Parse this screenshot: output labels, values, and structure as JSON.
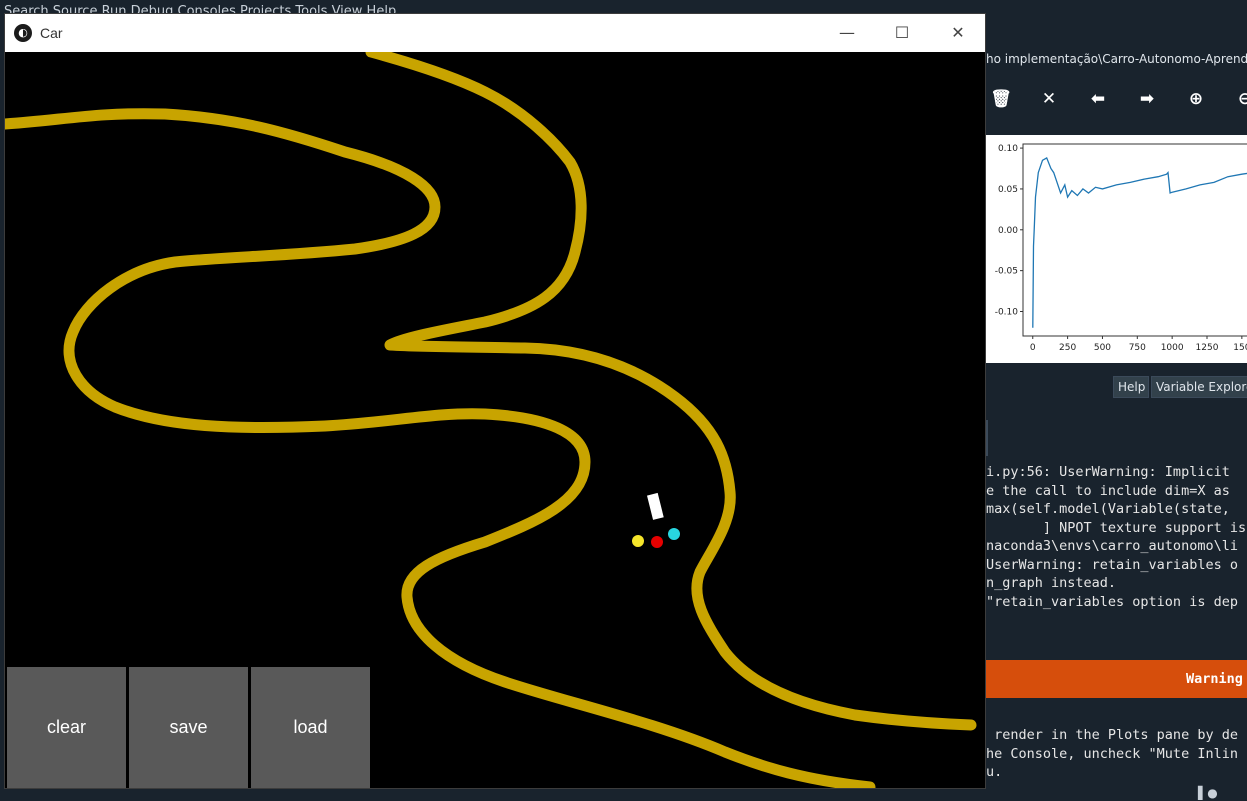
{
  "ide": {
    "menubar_text": "Search   Source   Run   Debug   Consoles   Projects   Tools   View   Help",
    "path_text": "ho implementação\\Carro-Autonomo-Aprendiz",
    "toolbar_icons": [
      "trash-icon",
      "close-all-icon",
      "arrow-left-icon",
      "arrow-right-icon",
      "zoom-in-icon",
      "zoom-out-icon"
    ],
    "pane_tabs": [
      "Help",
      "Variable Explorer"
    ],
    "console_lines": [
      "i.py:56: UserWarning: Implicit",
      "e the call to include dim=X as",
      "max(self.model(Variable(state,",
      "       ] NPOT texture support is",
      "naconda3\\envs\\carro_autonomo\\li",
      "UserWarning: retain_variables o",
      "n_graph instead.",
      "\"retain_variables option is dep",
      " render in the Plots pane by de",
      "he Console, uncheck \"Mute Inlin",
      "u."
    ],
    "warning_label": "Warning",
    "warning_color": "#d64e0c"
  },
  "plot": {
    "chart_data": {
      "type": "line",
      "yticks": [
        "0.10",
        "0.05",
        "0.00",
        "-0.05",
        "-0.10"
      ],
      "xticks": [
        "0",
        "250",
        "500",
        "750",
        "1000",
        "1250",
        "150"
      ],
      "ylim": [
        -0.13,
        0.105
      ],
      "xlim": [
        -70,
        1580
      ],
      "series": [
        {
          "color": "#1f77b4",
          "x": [
            0,
            5,
            10,
            20,
            40,
            70,
            100,
            130,
            150,
            170,
            200,
            230,
            250,
            280,
            320,
            360,
            400,
            450,
            500,
            600,
            700,
            800,
            900,
            960,
            970,
            985,
            1000,
            1100,
            1200,
            1300,
            1400,
            1500,
            1580
          ],
          "y": [
            -0.12,
            -0.02,
            0.0,
            0.04,
            0.07,
            0.085,
            0.088,
            0.075,
            0.07,
            0.06,
            0.045,
            0.055,
            0.04,
            0.048,
            0.042,
            0.05,
            0.045,
            0.052,
            0.05,
            0.055,
            0.058,
            0.062,
            0.065,
            0.068,
            0.07,
            0.045,
            0.046,
            0.05,
            0.055,
            0.058,
            0.065,
            0.068,
            0.07
          ]
        }
      ]
    }
  },
  "car_window": {
    "title": "Car",
    "minimize": "—",
    "maximize": "☐",
    "close": "✕",
    "buttons": {
      "clear": "clear",
      "save": "save",
      "load": "load"
    },
    "road_color": "#c8a400",
    "car": {
      "color": "#ffffff"
    },
    "sensors": [
      {
        "name": "sensor-yellow",
        "color": "#f5e52a"
      },
      {
        "name": "sensor-red",
        "color": "#e60000"
      },
      {
        "name": "sensor-cyan",
        "color": "#28d6e0"
      }
    ]
  }
}
